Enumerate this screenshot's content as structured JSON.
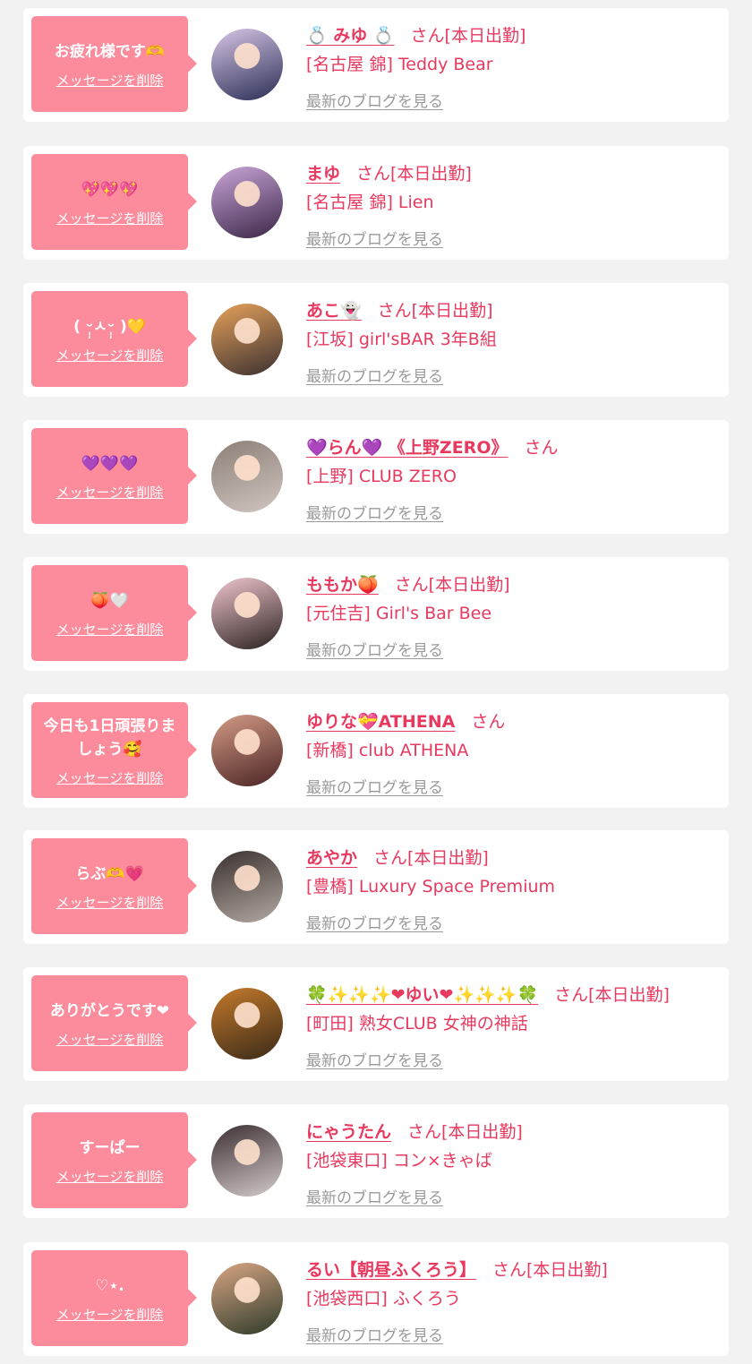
{
  "colors": {
    "page_background": "#f2f2f2",
    "card_background": "#ffffff",
    "bubble": "#fc8b9c",
    "accent_pink": "#e8395f",
    "link_gray": "#9a9a9a"
  },
  "items": [
    {
      "message": "お疲れ様です🫶",
      "delete_label": "メッセージを削除",
      "name": "💍 みゆ 💍",
      "suffix": "さん[本日出勤]",
      "shop": "[名古屋 錦] Teddy Bear",
      "blog_link": "最新のブログを見る",
      "avatar_colors": [
        "#2a2d55",
        "#d7c6e6"
      ]
    },
    {
      "message": "💖💖💖",
      "delete_label": "メッセージを削除",
      "name": "まゆ",
      "suffix": "さん[本日出勤]",
      "shop": "[名古屋 錦] Lien",
      "blog_link": "最新のブログを見る",
      "avatar_colors": [
        "#3b2647",
        "#c9a6d8"
      ]
    },
    {
      "message": "( ᵕ̩̩ㅅᵕ̩̩ )💛",
      "delete_label": "メッセージを削除",
      "name": "あこ👻",
      "suffix": "さん[本日出勤]",
      "shop": "[江坂] girl'sBAR 3年B組",
      "blog_link": "最新のブログを見る",
      "avatar_colors": [
        "#3b3030",
        "#e6a25b"
      ]
    },
    {
      "message": "💜💜💜",
      "delete_label": "メッセージを削除",
      "name": "💜らん💜 《上野ZERO》",
      "suffix": "さん",
      "shop": "[上野] CLUB ZERO",
      "blog_link": "最新のブログを見る",
      "avatar_colors": [
        "#cfc6bf",
        "#8c7f77"
      ]
    },
    {
      "message": "🍑🤍",
      "delete_label": "メッセージを削除",
      "name": "ももか🍑",
      "suffix": "さん[本日出勤]",
      "shop": "[元住吉] Girl's Bar Bee",
      "blog_link": "最新のブログを見る",
      "avatar_colors": [
        "#2b2220",
        "#f0c6cf"
      ]
    },
    {
      "message": "今日も1日頑張りましょう🥰",
      "delete_label": "メッセージを削除",
      "name": "ゆりな💝ATHENA",
      "suffix": "さん",
      "shop": "[新橋] club ATHENA",
      "blog_link": "最新のブログを見る",
      "avatar_colors": [
        "#4a2424",
        "#d49b86"
      ]
    },
    {
      "message": "らぶ🫶💗",
      "delete_label": "メッセージを削除",
      "name": "あやか",
      "suffix": "さん[本日出勤]",
      "shop": "[豊橋] Luxury Space Premium",
      "blog_link": "最新のブログを見る",
      "avatar_colors": [
        "#b3a9a4",
        "#3a302d"
      ]
    },
    {
      "message": "ありがとうです❤",
      "delete_label": "メッセージを削除",
      "name": "🍀✨✨✨❤ゆい❤✨✨✨🍀",
      "suffix": "さん[本日出勤]",
      "shop": "[町田] 熟女CLUB 女神の神話",
      "blog_link": "最新のブログを見る",
      "avatar_colors": [
        "#3a2a18",
        "#c47a2c"
      ]
    },
    {
      "message": "すーぱー",
      "delete_label": "メッセージを削除",
      "name": "にゃうたん",
      "suffix": "さん[本日出勤]",
      "shop": "[池袋東口] コン×きゃば",
      "blog_link": "最新のブログを見る",
      "avatar_colors": [
        "#d5cbcb",
        "#3c2f33"
      ]
    },
    {
      "message": "♡⋆.",
      "delete_label": "メッセージを削除",
      "name": "るい【朝昼ふくろう】",
      "suffix": "さん[本日出勤]",
      "shop": "[池袋西口] ふくろう",
      "blog_link": "最新のブログを見る",
      "avatar_colors": [
        "#2e3b2a",
        "#d9a684"
      ]
    }
  ]
}
